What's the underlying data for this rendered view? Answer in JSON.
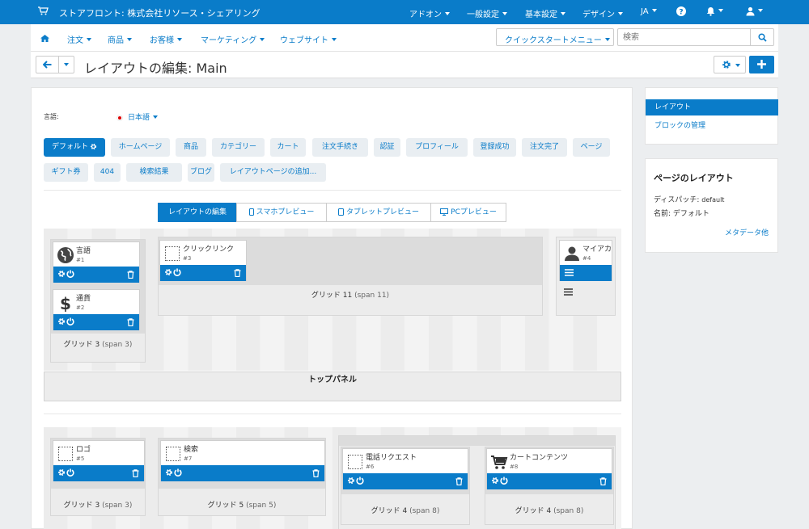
{
  "topbar": {
    "title": "ストアフロント: 株式会社リソース・シェアリング",
    "menus": [
      "アドオン",
      "一般設定",
      "基本設定",
      "デザイン",
      "JA"
    ]
  },
  "navbar": {
    "items": [
      "注文",
      "商品",
      "お客様",
      "マーケティング",
      "ウェブサイト"
    ],
    "quick_start": "クイックスタートメニュー",
    "search_placeholder": "検索"
  },
  "page": {
    "title": "レイアウトの編集: Main"
  },
  "language": {
    "label": "言語:",
    "value": "日本語"
  },
  "layout_tabs": [
    "デフォルト",
    "ホームページ",
    "商品",
    "カテゴリー",
    "カート",
    "注文手続き",
    "認証",
    "プロフィール",
    "登録成功",
    "注文完了",
    "ページ",
    "ギフト券",
    "404",
    "検索結果",
    "ブログ",
    "レイアウトページの追加..."
  ],
  "preview_tabs": [
    "レイアウトの編集",
    "スマホプレビュー",
    "タブレットプレビュー",
    "PCプレビュー"
  ],
  "containers": {
    "top_panel": "トップパネル",
    "header": {
      "grids": [
        {
          "label": "グリッド 3",
          "span": "(span 3)"
        },
        {
          "label": "グリッド 11",
          "span": "(span 11)"
        },
        {
          "label": "グリッド 3",
          "span": "(span 3)"
        },
        {
          "label": "グリッド 5",
          "span": "(span 5)"
        },
        {
          "label": "グリッド 4",
          "span": "(span 8)"
        },
        {
          "label": "グリッド 4",
          "span": "(span 8)"
        }
      ]
    },
    "blocks": [
      {
        "name": "言語",
        "id": "#1"
      },
      {
        "name": "通貨",
        "id": "#2"
      },
      {
        "name": "クリックリンク",
        "id": "#3"
      },
      {
        "name": "マイアカ",
        "id": "#4"
      },
      {
        "name": "ロゴ",
        "id": "#5"
      },
      {
        "name": "電話リクエスト",
        "id": "#6"
      },
      {
        "name": "検索",
        "id": "#7"
      },
      {
        "name": "カートコンテンツ",
        "id": "#8"
      }
    ]
  },
  "sidebar": {
    "nav": [
      "レイアウト",
      "ブロックの管理"
    ],
    "panel": {
      "title": "ページのレイアウト",
      "dispatch_label": "ディスパッチ:",
      "dispatch_value": "default",
      "name_label": "名前:",
      "name_value": "デフォルト",
      "more": "メタデータ他"
    }
  },
  "colors": {
    "accent": "#0a7cc9",
    "topbar": "#0a7cc9",
    "grid": "#ececec"
  }
}
